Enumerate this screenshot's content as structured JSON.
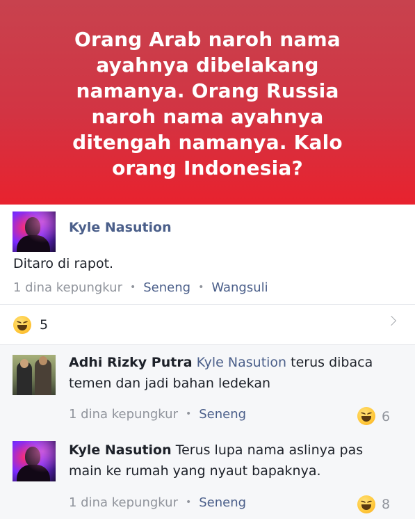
{
  "banner": {
    "text": "Orang Arab naroh nama ayahnya dibelakang namanya. Orang Russia naroh nama ayahnya ditengah namanya. Kalo orang Indonesia?"
  },
  "post": {
    "author": "Kyle Nasution",
    "comment": "Ditaro di rapot.",
    "time": "1 dina kepungkur",
    "like_label": "Seneng",
    "reply_label": "Wangsuli",
    "reaction_count": "5"
  },
  "replies": [
    {
      "author": "Adhi Rizky Putra",
      "tag": "Kyle Nasution",
      "text_line1": "terus dibaca",
      "text_line2": "temen dan jadi bahan ledekan",
      "time": "1 dina kepungkur",
      "like_label": "Seneng",
      "reaction_count": "6"
    },
    {
      "author": "Kyle Nasution",
      "text_line1": "Terus lupa nama aslinya pas",
      "text_line2": "main ke rumah yang nyaut bapaknya.",
      "time": "1 dina kepungkur",
      "like_label": "Seneng",
      "reaction_count": "8"
    }
  ],
  "icons": {
    "reaction": "haha-emoji-icon",
    "expand": "chevron-right-icon"
  },
  "colors": {
    "banner": "#d23443",
    "link": "#4b5f8a",
    "meta": "#90949c",
    "reply_bg": "#f6f7f9"
  }
}
